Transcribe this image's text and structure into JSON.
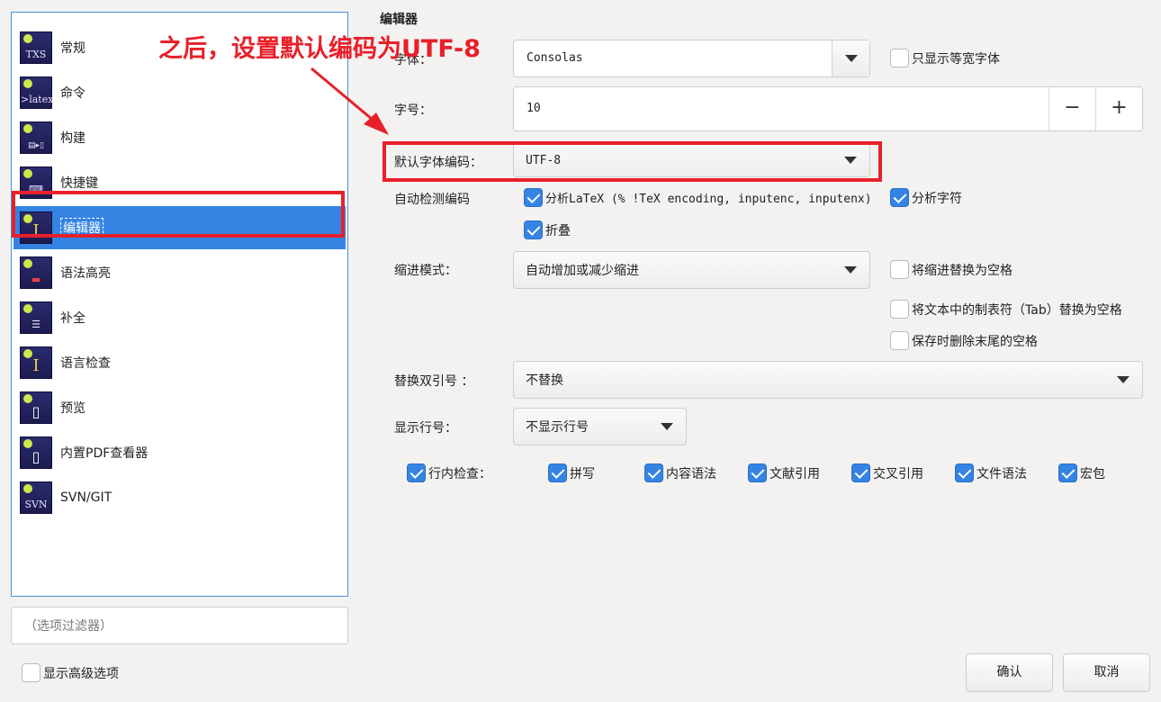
{
  "sidebar": {
    "items": [
      {
        "label": "常规",
        "icon": "TXS"
      },
      {
        "label": "命令",
        "icon": ">latex"
      },
      {
        "label": "构建",
        "icon": ""
      },
      {
        "label": "快捷键",
        "icon": ""
      },
      {
        "label": "编辑器",
        "icon": "I"
      },
      {
        "label": "语法高亮",
        "icon": ""
      },
      {
        "label": "补全",
        "icon": ""
      },
      {
        "label": "语言检查",
        "icon": "I"
      },
      {
        "label": "预览",
        "icon": ""
      },
      {
        "label": "内置PDF查看器",
        "icon": ""
      },
      {
        "label": "SVN/GIT",
        "icon": "SVN"
      }
    ],
    "selected_index": 4,
    "filter_placeholder": "（选项过滤器）",
    "advanced_label": "显示高级选项"
  },
  "editor": {
    "section_title": "编辑器",
    "font_label": "字体：",
    "font_value": "Consolas",
    "monospace_only_label": "只显示等宽字体",
    "size_label": "字号：",
    "size_value": "10",
    "minus": "−",
    "plus": "+",
    "encoding_label": "默认字体编码：",
    "encoding_value": "UTF-8",
    "autodetect_label": "自动检测编码",
    "detect_latex_label": "分析LaTeX (% !TeX encoding, inputenc, inputenx)",
    "detect_chars_label": "分析字符",
    "fold_label": "折叠",
    "indent_label": "缩进模式：",
    "indent_value": "自动增加或减少缩进",
    "indent_spaces_label": "将缩进替换为空格",
    "tab_spaces_label": "将文本中的制表符（Tab）替换为空格",
    "trim_label": "保存时删除末尾的空格",
    "quotes_label": "替换双引号 ：",
    "quotes_value": "不替换",
    "linenum_label": "显示行号：",
    "linenum_value": "不显示行号",
    "inline_checks": [
      "行内检查：",
      "拼写",
      "内容语法",
      "文献引用",
      "交叉引用",
      "文件语法",
      "宏包"
    ]
  },
  "buttons": {
    "ok": "确认",
    "cancel": "取消"
  },
  "annotation": {
    "text": "之后，设置默认编码为UTF-8",
    "color": "#e8202a"
  }
}
